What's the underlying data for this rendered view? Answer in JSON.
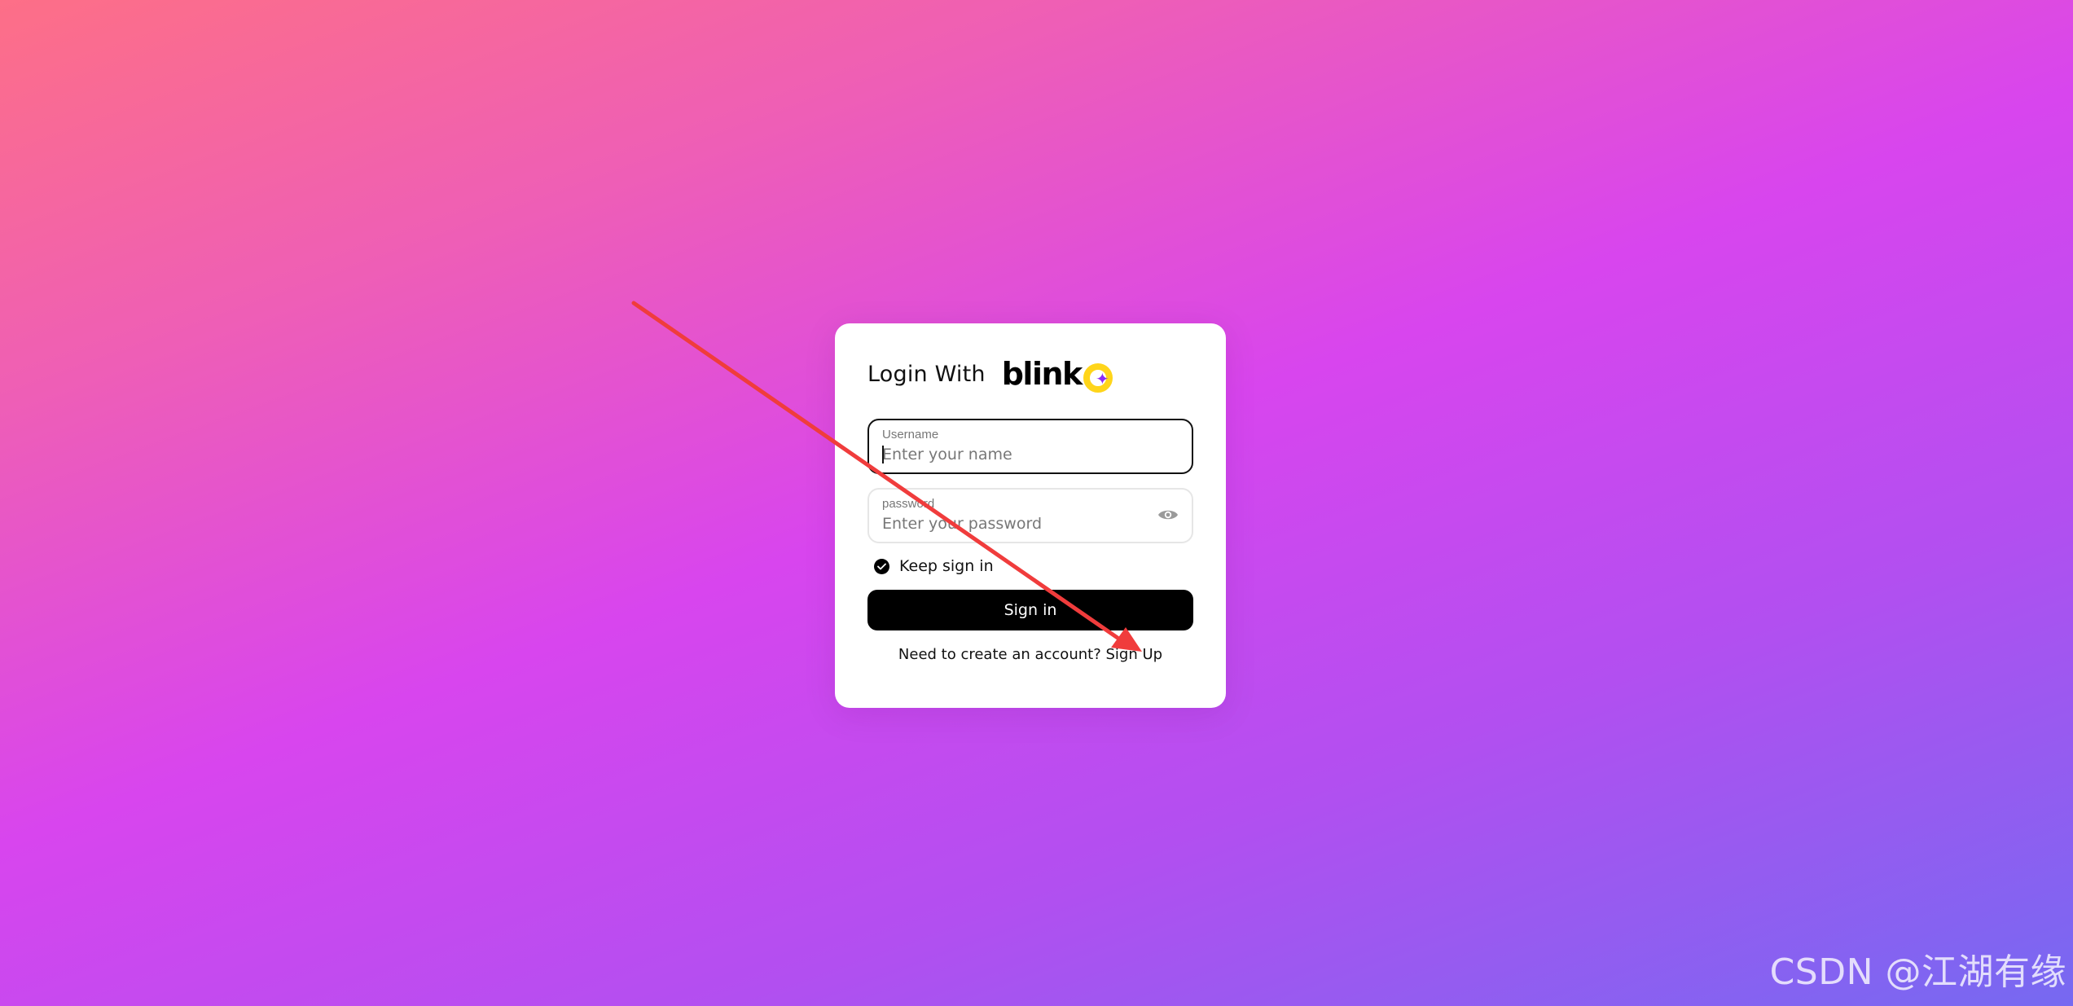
{
  "login": {
    "title": "Login With",
    "brand": "blink",
    "brand_colors": {
      "wordmark": "#000000",
      "ring": "#ffd51a",
      "spark": "#8c2cf5"
    },
    "username": {
      "label": "Username",
      "placeholder": "Enter your name",
      "value": ""
    },
    "password": {
      "label": "password",
      "placeholder": "Enter your password",
      "value": "",
      "toggle_icon": "eye-icon"
    },
    "keep_signed_in": {
      "label": "Keep sign in",
      "checked": true
    },
    "submit_label": "Sign in",
    "signup_prompt": "Need to create an account?",
    "signup_link": "Sign Up"
  },
  "annotation": {
    "color": "#f03c3c",
    "shape": "arrow"
  },
  "watermark": "CSDN @江湖有缘",
  "background": {
    "gradient": [
      "#fd6f87",
      "#d845ee",
      "#7669f1"
    ]
  }
}
